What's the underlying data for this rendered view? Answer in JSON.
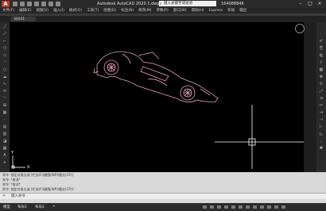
{
  "app": {
    "logo": "A",
    "title": "Autodesk AutoCAD 2020   1.dwg",
    "search_placeholder": "键入关键字或短语",
    "user": "164088846"
  },
  "menu": [
    "文件(F)",
    "编辑(E)",
    "视图(V)",
    "插入(I)",
    "格式(O)",
    "工具(T)",
    "绘图(D)",
    "标注(N)",
    "修改(M)",
    "参数(P)",
    "窗口(W)",
    "帮助(H)",
    "Express",
    "布局",
    "输出"
  ],
  "doc_tab": "码头01",
  "commands": [
    "命令: 指定对角点或 [栏选(F)/圈围(WP)/圈交(CP)]:",
    "命令: *取消*",
    "命令: *取消*",
    "命令: 指定对角点或 [栏选(F)/圈围(WP)/圈交(CP)]:"
  ],
  "command_prompt": "键入命令",
  "layout_tabs": [
    "模型",
    "布局1",
    "布局2",
    "+"
  ],
  "ucs": {
    "x": "X",
    "y": "Y"
  },
  "colors": {
    "car": "#e8a0b4",
    "crosshair": "#ffffff",
    "canvas": "#000000"
  }
}
